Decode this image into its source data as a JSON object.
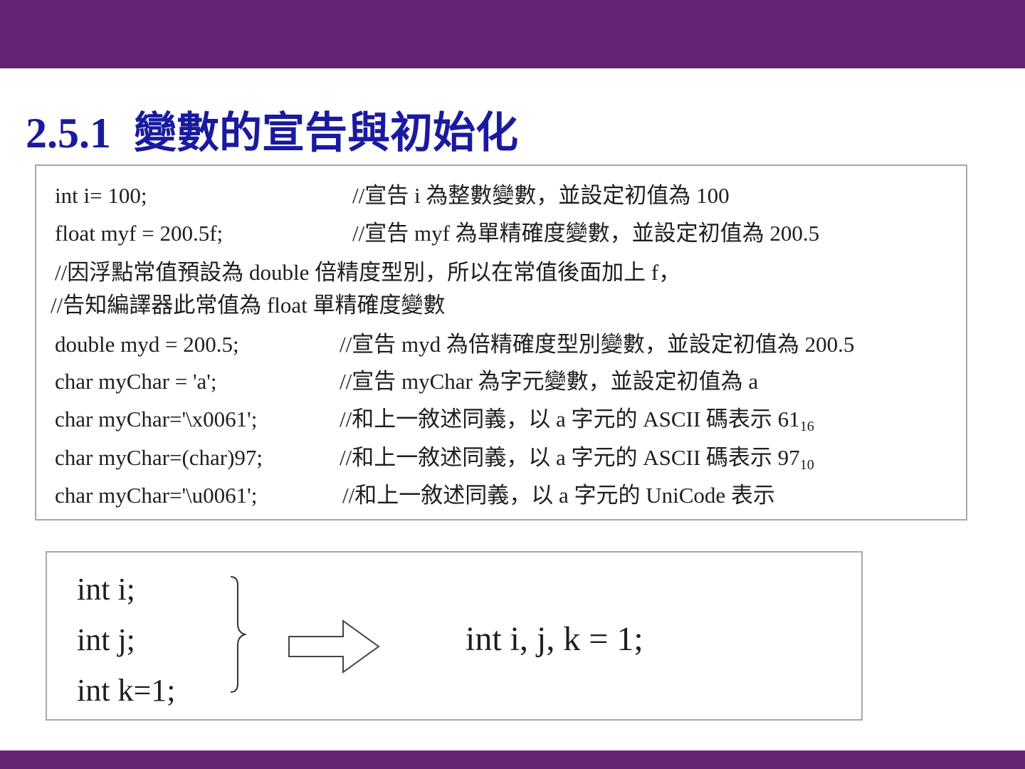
{
  "heading": {
    "number": "2.5.1",
    "text": "變數的宣告與初始化"
  },
  "code_lines": [
    {
      "code": "int i= 100;",
      "comment": "//宣告 i 為整數變數，並設定初值為 100"
    },
    {
      "code": "float myf = 200.5f;",
      "comment": "//宣告 myf 為單精確度變數，並設定初值為 200.5"
    },
    {
      "comment": "//因浮點常值預設為 double 倍精度型別，所以在常值後面加上 f，"
    },
    {
      "comment": "//告知編譯器此常值為 float 單精確度變數"
    },
    {
      "code": "double myd = 200.5;",
      "comment": "//宣告 myd 為倍精確度型別變數，並設定初值為 200.5"
    },
    {
      "code": "char myChar = 'a';",
      "comment": "//宣告 myChar 為字元變數，並設定初值為 a"
    },
    {
      "code": "char myChar='\\x0061';",
      "comment": "//和上一敘述同義，以 a 字元的 ASCII 碼表示 61",
      "sub": "16"
    },
    {
      "code": "char myChar=(char)97;",
      "comment": "//和上一敘述同義，以 a 字元的 ASCII 碼表示 97",
      "sub": "10"
    },
    {
      "code": "char myChar='\\u0061';",
      "comment": "//和上一敘述同義，以 a 字元的 UniCode 表示"
    }
  ],
  "example": {
    "separate": [
      "int i;",
      "int j;",
      "int k=1;"
    ],
    "combined": "int i, j, k = 1;"
  }
}
